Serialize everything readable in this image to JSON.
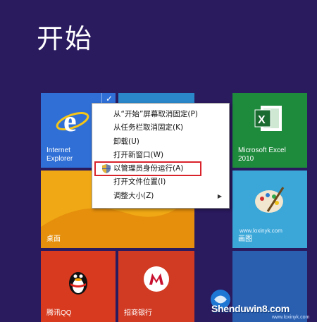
{
  "page": {
    "title": "开始"
  },
  "tiles": {
    "ie": {
      "label": "Internet\nExplorer"
    },
    "excel": {
      "label": "Microsoft Excel\n2010"
    },
    "desktop": {
      "label": "桌面"
    },
    "paint": {
      "label": "画图"
    },
    "qq": {
      "label": "腾讯QQ"
    },
    "bank": {
      "label": "招商银行"
    }
  },
  "context_menu": {
    "items": [
      {
        "label": "从“开始”屏幕取消固定(P)"
      },
      {
        "label": "从任务栏取消固定(K)"
      },
      {
        "label": "卸载(U)"
      },
      {
        "label": "打开新窗口(W)"
      },
      {
        "label": "以管理员身份运行(A)"
      },
      {
        "label": "打开文件位置(I)"
      },
      {
        "label": "调整大小(Z)"
      }
    ]
  },
  "watermark": {
    "text": "Shenduwin8.com",
    "url": "www.loxinyk.com",
    "site": "www.loxinyk.com"
  },
  "colors": {
    "background": "#2a1a5e",
    "highlight_border": "#d9232b"
  }
}
